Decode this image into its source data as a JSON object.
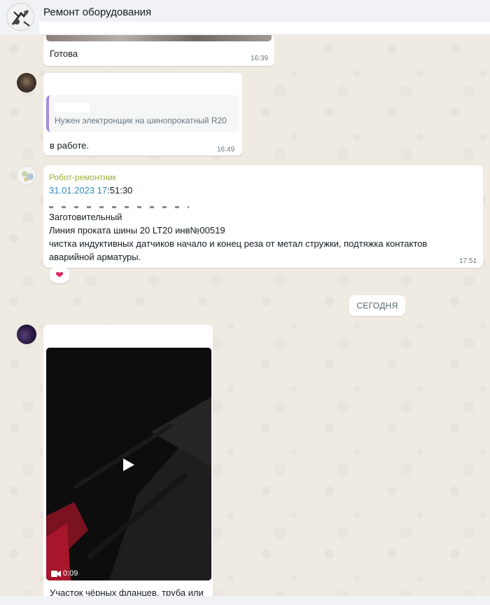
{
  "header": {
    "title": "Ремонт оборудования"
  },
  "messages": [
    {
      "text": "Готова",
      "time": "16:39"
    },
    {
      "quote_text": "Нужен электронщик на шинопрокатный R20",
      "text": "в работе.",
      "time": "16:49"
    },
    {
      "sender": "Робот-ремонтник",
      "date_link": "31.01.2023 17",
      "time_rest": ":51:30",
      "lines": [
        "Заготовительный",
        "Линия проката шины 20 LT20 инв№00519",
        "чистка индуктивных датчиков начало и конец реза от метал стружки, подтяжка контактов",
        "аварийной арматуры."
      ],
      "time": "17:51",
      "reaction": "❤"
    },
    {
      "video_duration": "0:09",
      "caption": "Участок чёрных фланцев, труба или"
    }
  ],
  "date_separator": "СЕГОДНЯ",
  "colors": {
    "background": "#efeae2",
    "header": "#f0f2f5",
    "bubble": "#ffffff",
    "quote_bar": "#a58ce0",
    "sender": "#9fad34",
    "link": "#2b8dbe",
    "timestamp": "#667781"
  },
  "icons": [
    "group-avatar-icon",
    "play-icon",
    "video-camera-icon",
    "heart-reaction-icon"
  ]
}
